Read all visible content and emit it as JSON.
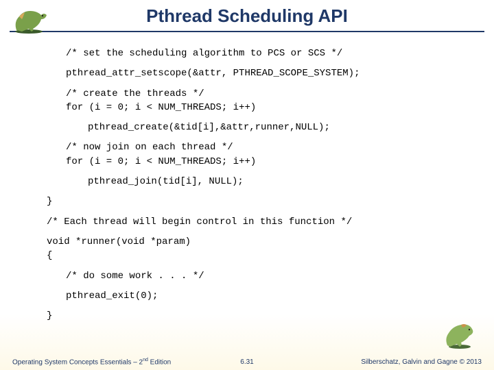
{
  "header": {
    "title": "Pthread Scheduling API"
  },
  "code": {
    "c1": "/* set the scheduling algorithm to PCS or SCS */",
    "c2": "pthread_attr_setscope(&attr, PTHREAD_SCOPE_SYSTEM);",
    "c3": "/* create the threads */\nfor (i = 0; i < NUM_THREADS; i++)",
    "c4": "pthread_create(&tid[i],&attr,runner,NULL);",
    "c5": "/* now join on each thread */\nfor (i = 0; i < NUM_THREADS; i++)",
    "c6": "pthread_join(tid[i], NULL);",
    "c7": "}",
    "c8": "/* Each thread will begin control in this function */",
    "c9": "void *runner(void *param)\n{",
    "c10": "/* do some work . . . */",
    "c11": "pthread_exit(0);",
    "c12": "}"
  },
  "footer": {
    "left_a": "Operating System Concepts Essentials – 2",
    "left_sup": "nd",
    "left_b": " Edition",
    "center": "6.31",
    "right": "Silberschatz, Galvin and Gagne © 2013"
  }
}
